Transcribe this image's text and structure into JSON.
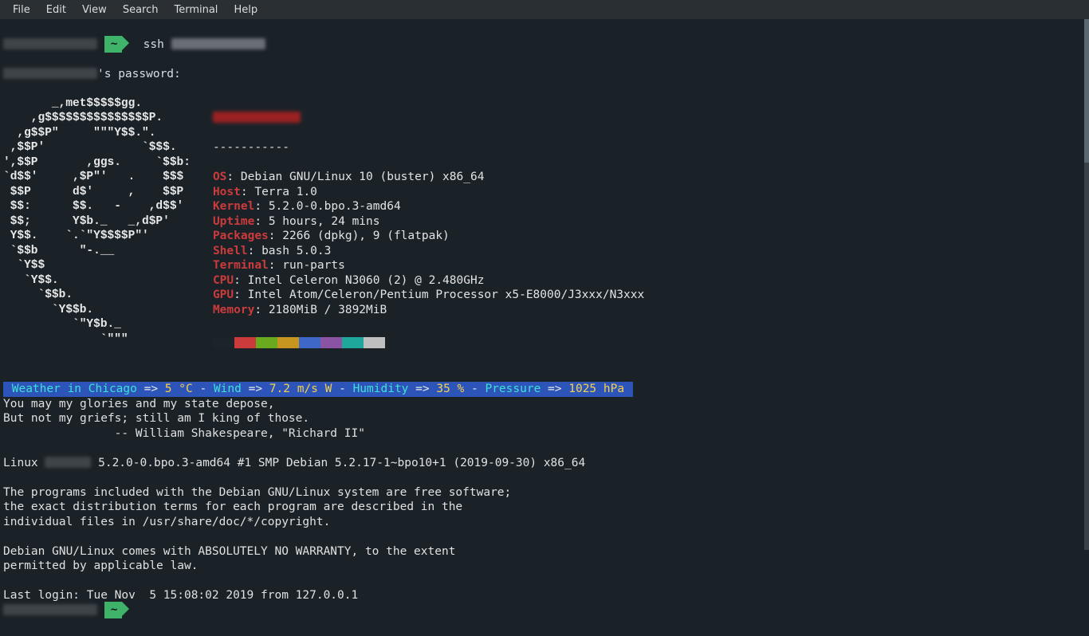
{
  "menu": {
    "items": [
      "File",
      "Edit",
      "View",
      "Search",
      "Terminal",
      "Help"
    ]
  },
  "prompt1": {
    "path": "~",
    "command": "ssh"
  },
  "password_prompt": "'s password:",
  "ascii_art_lines": [
    "       _,met$$$$$gg.",
    "    ,g$$$$$$$$$$$$$$$P.",
    "  ,g$$P\"     \"\"\"Y$$.\".",
    " ,$$P'              `$$$.",
    "',$$P       ,ggs.     `$$b:",
    "`d$$'     ,$P\"'   .    $$$",
    " $$P      d$'     ,    $$P",
    " $$:      $$.   -    ,d$$'",
    " $$;      Y$b._   _,d$P'",
    " Y$$.    `.`\"Y$$$$P\"'",
    " `$$b      \"-.__",
    "  `Y$$",
    "   `Y$$.",
    "     `$$b.",
    "       `Y$$b.",
    "          `\"Y$b._",
    "              `\"\"\""
  ],
  "neofetch_dashes": "-----------",
  "neofetch": [
    {
      "key": "OS",
      "value": "Debian GNU/Linux 10 (buster) x86_64"
    },
    {
      "key": "Host",
      "value": "Terra 1.0"
    },
    {
      "key": "Kernel",
      "value": "5.2.0-0.bpo.3-amd64"
    },
    {
      "key": "Uptime",
      "value": "5 hours, 24 mins"
    },
    {
      "key": "Packages",
      "value": "2266 (dpkg), 9 (flatpak)"
    },
    {
      "key": "Shell",
      "value": "bash 5.0.3"
    },
    {
      "key": "Terminal",
      "value": "run-parts"
    },
    {
      "key": "CPU",
      "value": "Intel Celeron N3060 (2) @ 2.480GHz"
    },
    {
      "key": "GPU",
      "value": "Intel Atom/Celeron/Pentium Processor x5-E8000/J3xxx/N3xxx"
    },
    {
      "key": "Memory",
      "value": "2180MiB / 3892MiB"
    }
  ],
  "swatch_colors": [
    "#1c2329",
    "#cc3b3b",
    "#6aaa1f",
    "#c7961f",
    "#3e67c7",
    "#8a53a3",
    "#1fa79b",
    "#bfbfbf"
  ],
  "weather": {
    "label1": " Weather in Chicago ",
    "arrow": "=>",
    "temp": " 5 °C ",
    "dash": "- ",
    "wind_label": "Wind ",
    "wind_val": " 7.2 m/s W ",
    "hum_label": "Humidity ",
    "hum_val": " 35 % ",
    "press_label": "Pressure ",
    "press_val": " 1025 hPa "
  },
  "motd": [
    "You may my glories and my state depose,",
    "But not my griefs; still am I king of those.",
    "                -- William Shakespeare, \"Richard II\""
  ],
  "uname_prefix": "Linux ",
  "uname_suffix": " 5.2.0-0.bpo.3-amd64 #1 SMP Debian 5.2.17-1~bpo10+1 (2019-09-30) x86_64",
  "debian_msg": [
    "The programs included with the Debian GNU/Linux system are free software;",
    "the exact distribution terms for each program are described in the",
    "individual files in /usr/share/doc/*/copyright.",
    "",
    "Debian GNU/Linux comes with ABSOLUTELY NO WARRANTY, to the extent",
    "permitted by applicable law."
  ],
  "last_login": "Last login: Tue Nov  5 15:08:02 2019 from 127.0.0.1",
  "prompt2": {
    "path": "~"
  }
}
